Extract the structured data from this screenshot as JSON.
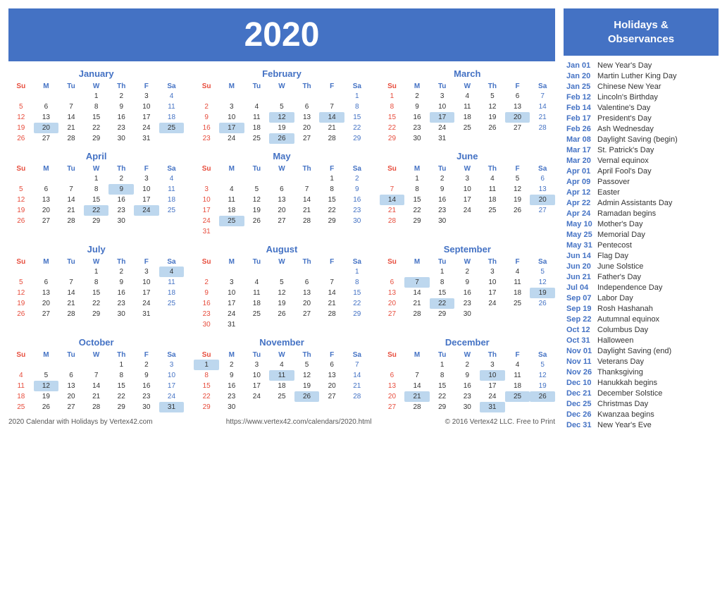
{
  "header": {
    "year": "2020"
  },
  "months": [
    {
      "name": "January",
      "days": [
        [
          "",
          "",
          "",
          "1",
          "2",
          "3",
          "4"
        ],
        [
          "5",
          "6",
          "7",
          "8",
          "9",
          "10",
          "11"
        ],
        [
          "12",
          "13",
          "14",
          "15",
          "16",
          "17",
          "18"
        ],
        [
          "19",
          "20",
          "21",
          "22",
          "23",
          "24",
          "25"
        ],
        [
          "26",
          "27",
          "28",
          "29",
          "30",
          "31",
          ""
        ]
      ],
      "highlights": {
        "4": "saturday",
        "11": "saturday",
        "18": "saturday",
        "25": "light-blue",
        "1": "regular",
        "2": "regular",
        "3": "regular",
        "5": "sunday",
        "12": "sunday",
        "19": "sunday",
        "26": "sunday",
        "20": "light-blue"
      }
    },
    {
      "name": "February",
      "days": [
        [
          "",
          "",
          "",
          "",
          "",
          "",
          "1"
        ],
        [
          "2",
          "3",
          "4",
          "5",
          "6",
          "7",
          "8"
        ],
        [
          "9",
          "10",
          "11",
          "12",
          "13",
          "14",
          "15"
        ],
        [
          "16",
          "17",
          "18",
          "19",
          "20",
          "21",
          "22"
        ],
        [
          "23",
          "24",
          "25",
          "26",
          "27",
          "28",
          "29"
        ]
      ],
      "highlights": {
        "1": "saturday",
        "8": "saturday",
        "15": "saturday",
        "22": "saturday",
        "29": "saturday",
        "2": "sunday",
        "9": "sunday",
        "16": "sunday",
        "23": "sunday",
        "12": "light-blue",
        "14": "light-blue",
        "17": "light-blue",
        "26": "light-blue"
      }
    },
    {
      "name": "March",
      "days": [
        [
          "1",
          "2",
          "3",
          "4",
          "5",
          "6",
          "7"
        ],
        [
          "8",
          "9",
          "10",
          "11",
          "12",
          "13",
          "14"
        ],
        [
          "15",
          "16",
          "17",
          "18",
          "19",
          "20",
          "21"
        ],
        [
          "22",
          "23",
          "24",
          "25",
          "26",
          "27",
          "28"
        ],
        [
          "29",
          "30",
          "31",
          "",
          "",
          "",
          ""
        ]
      ],
      "highlights": {
        "7": "saturday",
        "14": "saturday",
        "21": "saturday",
        "28": "saturday",
        "1": "sunday",
        "8": "sunday",
        "15": "sunday",
        "22": "sunday",
        "29": "sunday",
        "17": "light-blue",
        "20": "light-blue"
      }
    },
    {
      "name": "April",
      "days": [
        [
          "",
          "",
          "",
          "1",
          "2",
          "3",
          "4"
        ],
        [
          "5",
          "6",
          "7",
          "8",
          "9",
          "10",
          "11"
        ],
        [
          "12",
          "13",
          "14",
          "15",
          "16",
          "17",
          "18"
        ],
        [
          "19",
          "20",
          "21",
          "22",
          "23",
          "24",
          "25"
        ],
        [
          "26",
          "27",
          "28",
          "29",
          "30",
          "",
          ""
        ]
      ],
      "highlights": {
        "4": "saturday",
        "11": "saturday",
        "18": "saturday",
        "25": "saturday",
        "5": "sunday",
        "12": "sunday",
        "19": "sunday",
        "26": "sunday",
        "1": "regular",
        "9": "light-blue",
        "22": "light-blue",
        "24": "light-blue"
      }
    },
    {
      "name": "May",
      "days": [
        [
          "",
          "",
          "",
          "",
          "",
          "1",
          "2"
        ],
        [
          "3",
          "4",
          "5",
          "6",
          "7",
          "8",
          "9"
        ],
        [
          "10",
          "11",
          "12",
          "13",
          "14",
          "15",
          "16"
        ],
        [
          "17",
          "18",
          "19",
          "20",
          "21",
          "22",
          "23"
        ],
        [
          "24",
          "25",
          "26",
          "27",
          "28",
          "29",
          "30"
        ],
        [
          "31",
          "",
          "",
          "",
          "",
          "",
          ""
        ]
      ],
      "highlights": {
        "2": "saturday",
        "9": "saturday",
        "16": "saturday",
        "23": "saturday",
        "30": "saturday",
        "3": "sunday",
        "10": "sunday",
        "17": "sunday",
        "24": "sunday",
        "31": "sunday",
        "1": "regular",
        "25": "light-blue"
      }
    },
    {
      "name": "June",
      "days": [
        [
          "",
          "1",
          "2",
          "3",
          "4",
          "5",
          "6"
        ],
        [
          "7",
          "8",
          "9",
          "10",
          "11",
          "12",
          "13"
        ],
        [
          "14",
          "15",
          "16",
          "17",
          "18",
          "19",
          "20"
        ],
        [
          "21",
          "22",
          "23",
          "24",
          "25",
          "26",
          "27"
        ],
        [
          "28",
          "29",
          "30",
          "",
          "",
          "",
          ""
        ]
      ],
      "highlights": {
        "6": "saturday",
        "13": "saturday",
        "20": "light-blue",
        "27": "saturday",
        "7": "sunday",
        "14": "light-blue",
        "21": "sunday",
        "28": "sunday"
      }
    },
    {
      "name": "July",
      "days": [
        [
          "",
          "",
          "",
          "1",
          "2",
          "3",
          "4"
        ],
        [
          "5",
          "6",
          "7",
          "8",
          "9",
          "10",
          "11"
        ],
        [
          "12",
          "13",
          "14",
          "15",
          "16",
          "17",
          "18"
        ],
        [
          "19",
          "20",
          "21",
          "22",
          "23",
          "24",
          "25"
        ],
        [
          "26",
          "27",
          "28",
          "29",
          "30",
          "31",
          ""
        ]
      ],
      "highlights": {
        "4": "light-blue",
        "11": "saturday",
        "18": "saturday",
        "25": "saturday",
        "5": "sunday",
        "12": "sunday",
        "19": "sunday",
        "26": "sunday",
        "3": "regular",
        "1": "regular",
        "2": "regular"
      }
    },
    {
      "name": "August",
      "days": [
        [
          "",
          "",
          "",
          "",
          "",
          "",
          "1"
        ],
        [
          "2",
          "3",
          "4",
          "5",
          "6",
          "7",
          "8"
        ],
        [
          "9",
          "10",
          "11",
          "12",
          "13",
          "14",
          "15"
        ],
        [
          "16",
          "17",
          "18",
          "19",
          "20",
          "21",
          "22"
        ],
        [
          "23",
          "24",
          "25",
          "26",
          "27",
          "28",
          "29"
        ],
        [
          "30",
          "31",
          "",
          "",
          "",
          "",
          ""
        ]
      ],
      "highlights": {
        "1": "saturday",
        "8": "saturday",
        "15": "saturday",
        "22": "saturday",
        "29": "saturday",
        "2": "sunday",
        "9": "sunday",
        "16": "sunday",
        "23": "sunday",
        "30": "sunday"
      }
    },
    {
      "name": "September",
      "days": [
        [
          "",
          "",
          "1",
          "2",
          "3",
          "4",
          "5"
        ],
        [
          "6",
          "7",
          "8",
          "9",
          "10",
          "11",
          "12"
        ],
        [
          "13",
          "14",
          "15",
          "16",
          "17",
          "18",
          "19"
        ],
        [
          "20",
          "21",
          "22",
          "23",
          "24",
          "25",
          "26"
        ],
        [
          "27",
          "28",
          "29",
          "30",
          "",
          "",
          ""
        ]
      ],
      "highlights": {
        "5": "saturday",
        "12": "saturday",
        "19": "light-blue",
        "26": "saturday",
        "6": "sunday",
        "13": "sunday",
        "20": "sunday",
        "27": "sunday",
        "7": "light-blue",
        "22": "light-blue"
      }
    },
    {
      "name": "October",
      "days": [
        [
          "",
          "",
          "",
          "",
          "1",
          "2",
          "3"
        ],
        [
          "4",
          "5",
          "6",
          "7",
          "8",
          "9",
          "10"
        ],
        [
          "11",
          "12",
          "13",
          "14",
          "15",
          "16",
          "17"
        ],
        [
          "18",
          "19",
          "20",
          "21",
          "22",
          "23",
          "24"
        ],
        [
          "25",
          "26",
          "27",
          "28",
          "29",
          "30",
          "31"
        ]
      ],
      "highlights": {
        "3": "saturday",
        "10": "saturday",
        "17": "saturday",
        "24": "saturday",
        "31": "light-blue",
        "4": "sunday",
        "11": "sunday",
        "18": "sunday",
        "25": "sunday",
        "12": "light-blue"
      }
    },
    {
      "name": "November",
      "days": [
        [
          "1",
          "2",
          "3",
          "4",
          "5",
          "6",
          "7"
        ],
        [
          "8",
          "9",
          "10",
          "11",
          "12",
          "13",
          "14"
        ],
        [
          "15",
          "16",
          "17",
          "18",
          "19",
          "20",
          "21"
        ],
        [
          "22",
          "23",
          "24",
          "25",
          "26",
          "27",
          "28"
        ],
        [
          "29",
          "30",
          "",
          "",
          "",
          "",
          ""
        ]
      ],
      "highlights": {
        "7": "saturday",
        "14": "saturday",
        "21": "saturday",
        "28": "saturday",
        "1": "light-blue",
        "8": "sunday",
        "15": "sunday",
        "22": "sunday",
        "29": "sunday",
        "11": "light-blue",
        "26": "light-blue"
      }
    },
    {
      "name": "December",
      "days": [
        [
          "",
          "",
          "1",
          "2",
          "3",
          "4",
          "5"
        ],
        [
          "6",
          "7",
          "8",
          "9",
          "10",
          "11",
          "12"
        ],
        [
          "13",
          "14",
          "15",
          "16",
          "17",
          "18",
          "19"
        ],
        [
          "20",
          "21",
          "22",
          "23",
          "24",
          "25",
          "26"
        ],
        [
          "27",
          "28",
          "29",
          "30",
          "31",
          "",
          ""
        ]
      ],
      "highlights": {
        "5": "saturday",
        "12": "saturday",
        "19": "saturday",
        "26": "light-blue",
        "6": "sunday",
        "13": "sunday",
        "20": "sunday",
        "27": "sunday",
        "10": "light-blue",
        "21": "light-blue",
        "25": "light-blue",
        "31": "light-blue"
      }
    }
  ],
  "holidays": [
    {
      "date": "Jan 01",
      "name": "New Year's Day"
    },
    {
      "date": "Jan 20",
      "name": "Martin Luther King Day"
    },
    {
      "date": "Jan 25",
      "name": "Chinese New Year"
    },
    {
      "date": "Feb 12",
      "name": "Lincoln's Birthday"
    },
    {
      "date": "Feb 14",
      "name": "Valentine's Day"
    },
    {
      "date": "Feb 17",
      "name": "President's Day"
    },
    {
      "date": "Feb 26",
      "name": "Ash Wednesday"
    },
    {
      "date": "Mar 08",
      "name": "Daylight Saving (begin)"
    },
    {
      "date": "Mar 17",
      "name": "St. Patrick's Day"
    },
    {
      "date": "Mar 20",
      "name": "Vernal equinox"
    },
    {
      "date": "Apr 01",
      "name": "April Fool's Day"
    },
    {
      "date": "Apr 09",
      "name": "Passover"
    },
    {
      "date": "Apr 12",
      "name": "Easter"
    },
    {
      "date": "Apr 22",
      "name": "Admin Assistants Day"
    },
    {
      "date": "Apr 24",
      "name": "Ramadan begins"
    },
    {
      "date": "May 10",
      "name": "Mother's Day"
    },
    {
      "date": "May 25",
      "name": "Memorial Day"
    },
    {
      "date": "May 31",
      "name": "Pentecost"
    },
    {
      "date": "Jun 14",
      "name": "Flag Day"
    },
    {
      "date": "Jun 20",
      "name": "June Solstice"
    },
    {
      "date": "Jun 21",
      "name": "Father's Day"
    },
    {
      "date": "Jul 04",
      "name": "Independence Day"
    },
    {
      "date": "Sep 07",
      "name": "Labor Day"
    },
    {
      "date": "Sep 19",
      "name": "Rosh Hashanah"
    },
    {
      "date": "Sep 22",
      "name": "Autumnal equinox"
    },
    {
      "date": "Oct 12",
      "name": "Columbus Day"
    },
    {
      "date": "Oct 31",
      "name": "Halloween"
    },
    {
      "date": "Nov 01",
      "name": "Daylight Saving (end)"
    },
    {
      "date": "Nov 11",
      "name": "Veterans Day"
    },
    {
      "date": "Nov 26",
      "name": "Thanksgiving"
    },
    {
      "date": "Dec 10",
      "name": "Hanukkah begins"
    },
    {
      "date": "Dec 21",
      "name": "December Solstice"
    },
    {
      "date": "Dec 25",
      "name": "Christmas Day"
    },
    {
      "date": "Dec 26",
      "name": "Kwanzaa begins"
    },
    {
      "date": "Dec 31",
      "name": "New Year's Eve"
    }
  ],
  "sidebar_header": "Holidays &\nObservances",
  "footer": {
    "left": "2020 Calendar with Holidays by Vertex42.com",
    "center": "https://www.vertex42.com/calendars/2020.html",
    "right": "© 2016 Vertex42 LLC. Free to Print"
  },
  "days_of_week": [
    "Su",
    "M",
    "Tu",
    "W",
    "Th",
    "F",
    "Sa"
  ]
}
